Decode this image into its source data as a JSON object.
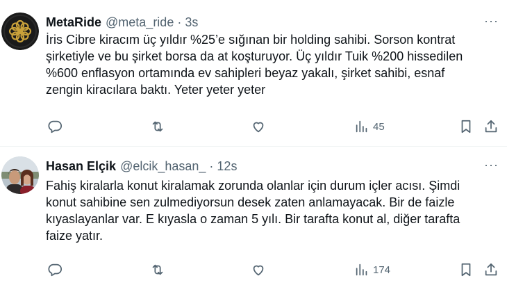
{
  "tweets": [
    {
      "name": "MetaRide",
      "handle": "@meta_ride",
      "separator": "·",
      "time": "3s",
      "more": "···",
      "lines": [
        "İris Cibre kiracım üç yıldır %25’e sığınan bir holding sahibi. Sorson kontrat",
        "şirketiyle ve bu şirket borsa da at koşturuyor. Üç yıldır Tuik %200 hissedilen",
        "%600 enflasyon ortamında ev sahipleri beyaz yakalı, şirket sahibi, esnaf",
        "zengin kiracılara baktı. Yeter yeter yeter"
      ],
      "views": "45",
      "icons": [
        "reply-icon",
        "retweet-icon",
        "like-icon",
        "views-icon",
        "bookmark-icon",
        "share-icon"
      ]
    },
    {
      "name": "Hasan Elçik",
      "handle": "@elcik_hasan_",
      "separator": "·",
      "time": "12s",
      "more": "···",
      "lines": [
        "Fahiş kiralarla konut kiralamak zorunda olanlar için durum içler acısı. Şimdi",
        "konut sahibine sen zulmediyorsun desek zaten anlamayacak. Bir de faizle",
        "kıyaslayanlar var. E kıyasla o zaman 5 yılı. Bir tarafta konut al, diğer tarafta",
        "faize yatır."
      ],
      "views": "174",
      "icons": [
        "reply-icon",
        "retweet-icon",
        "like-icon",
        "views-icon",
        "bookmark-icon",
        "share-icon"
      ]
    }
  ],
  "colors": {
    "text": "#0f1419",
    "secondary": "#536471",
    "divider": "#eff3f4",
    "background": "#ffffff"
  }
}
